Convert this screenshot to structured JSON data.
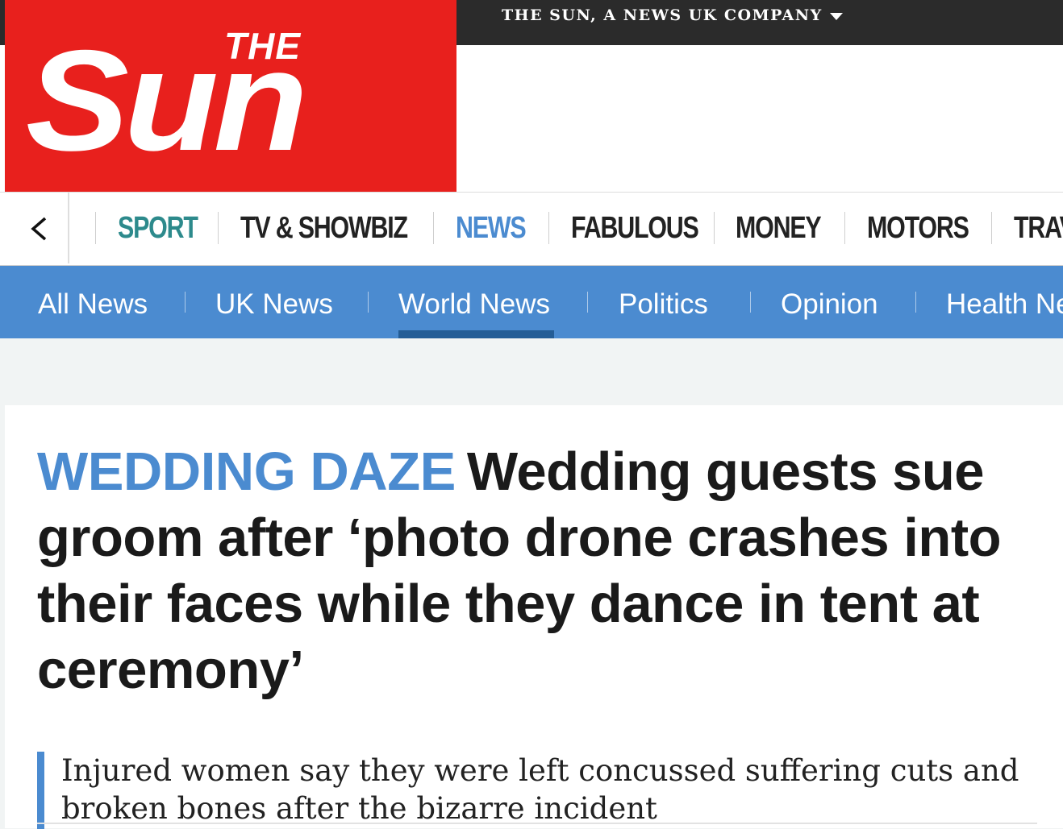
{
  "masthead": {
    "company_label": "THE SUN, A NEWS UK COMPANY",
    "logo_top": "THE",
    "logo_main": "Sun",
    "brand_red": "#e8201d"
  },
  "primary_nav": {
    "back_icon": "chevron-left-icon",
    "items": [
      {
        "label": "SPORT",
        "color": "#2d8a8c"
      },
      {
        "label": "TV & SHOWBIZ",
        "color": "#222222"
      },
      {
        "label": "NEWS",
        "color": "#4b8bd0",
        "active": true
      },
      {
        "label": "FABULOUS",
        "color": "#222222"
      },
      {
        "label": "MONEY",
        "color": "#222222"
      },
      {
        "label": "MOTORS",
        "color": "#222222"
      },
      {
        "label": "TRAV",
        "color": "#222222"
      }
    ]
  },
  "sub_nav": {
    "items": [
      {
        "label": "All News"
      },
      {
        "label": "UK News"
      },
      {
        "label": "World News",
        "active": true
      },
      {
        "label": "Politics"
      },
      {
        "label": "Opinion"
      },
      {
        "label": "Health Ne"
      }
    ],
    "color": "#4b8bd0"
  },
  "article": {
    "kicker": "WEDDING DAZE",
    "headline": "Wedding guests sue groom after ‘photo drone crashes into their faces while they dance in tent at ceremony’",
    "standfirst": "Injured women say they were left concussed suffering cuts and broken bones after the bizarre incident"
  }
}
